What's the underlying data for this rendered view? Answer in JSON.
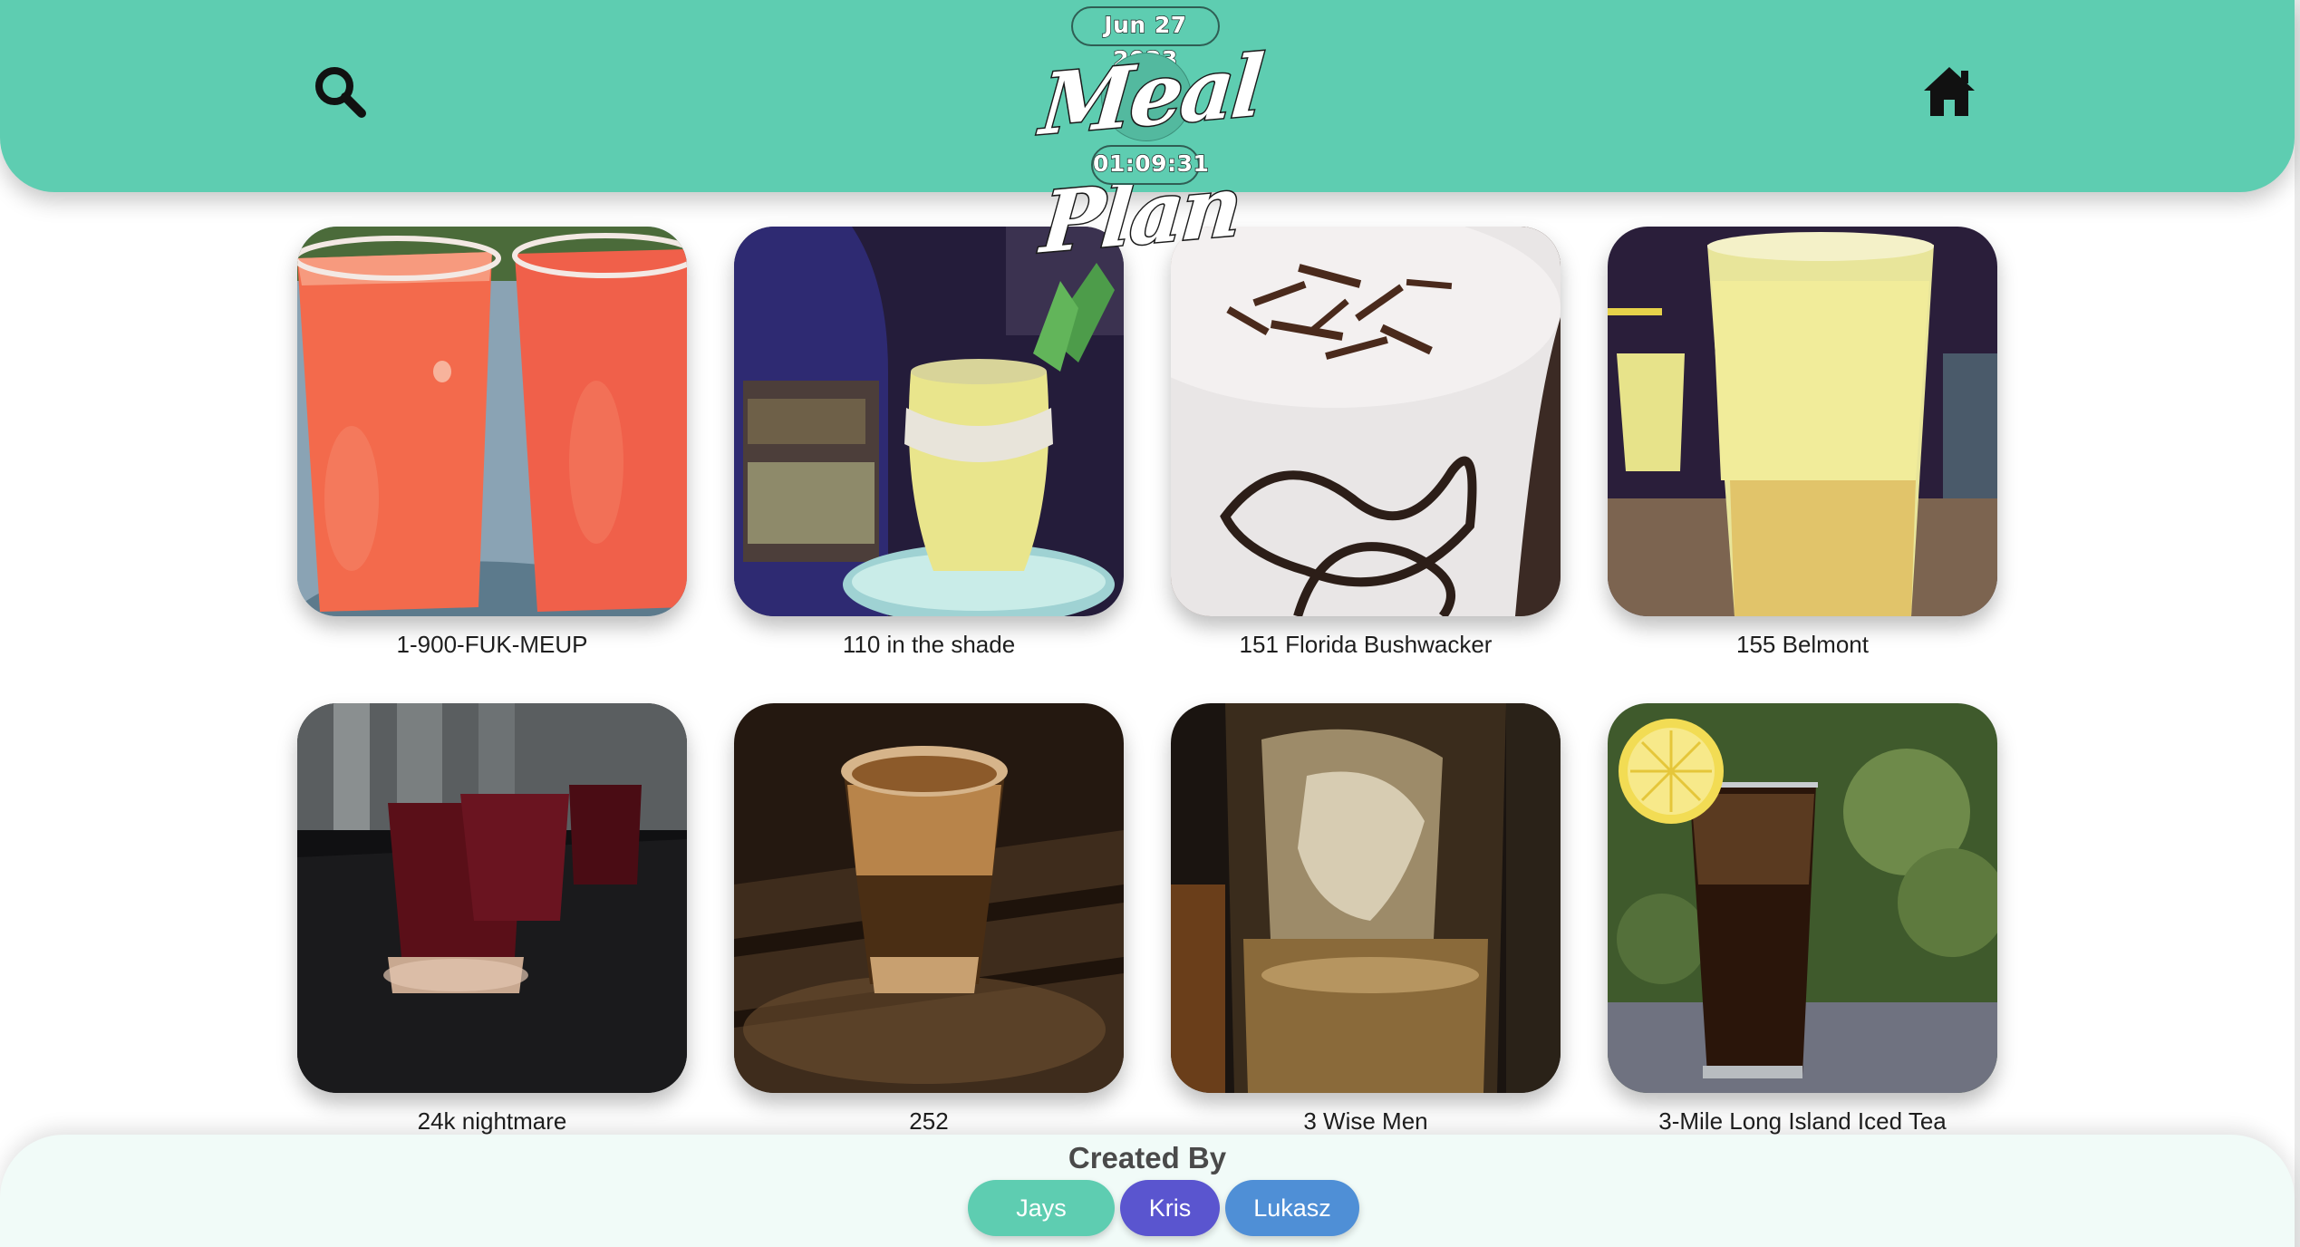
{
  "header": {
    "date": "Jun 27 2023",
    "time": "01:09:31",
    "logo_text": "Meal Plan",
    "search_icon": "search-icon",
    "home_icon": "home-icon",
    "color": "#5ecdb1"
  },
  "drinks": [
    {
      "name": "1-900-FUK-MEUP"
    },
    {
      "name": "110 in the shade"
    },
    {
      "name": "151 Florida Bushwacker"
    },
    {
      "name": "155 Belmont"
    },
    {
      "name": "24k nightmare"
    },
    {
      "name": "252"
    },
    {
      "name": "3 Wise Men"
    },
    {
      "name": "3-Mile Long Island Iced Tea"
    }
  ],
  "footer": {
    "title": "Created By",
    "authors": [
      {
        "name": "Jays",
        "color": "#5ecdb1"
      },
      {
        "name": "Kris",
        "color": "#5a55cf"
      },
      {
        "name": "Lukasz",
        "color": "#4f8fd6"
      }
    ]
  }
}
